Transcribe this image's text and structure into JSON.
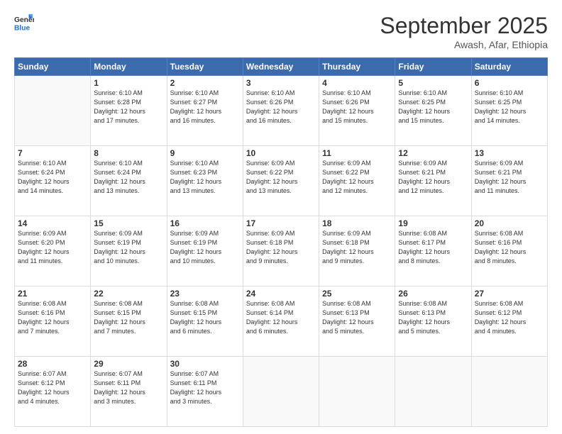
{
  "header": {
    "logo_line1": "General",
    "logo_line2": "Blue",
    "month": "September 2025",
    "location": "Awash, Afar, Ethiopia"
  },
  "weekdays": [
    "Sunday",
    "Monday",
    "Tuesday",
    "Wednesday",
    "Thursday",
    "Friday",
    "Saturday"
  ],
  "weeks": [
    [
      {
        "num": "",
        "info": ""
      },
      {
        "num": "1",
        "info": "Sunrise: 6:10 AM\nSunset: 6:28 PM\nDaylight: 12 hours\nand 17 minutes."
      },
      {
        "num": "2",
        "info": "Sunrise: 6:10 AM\nSunset: 6:27 PM\nDaylight: 12 hours\nand 16 minutes."
      },
      {
        "num": "3",
        "info": "Sunrise: 6:10 AM\nSunset: 6:26 PM\nDaylight: 12 hours\nand 16 minutes."
      },
      {
        "num": "4",
        "info": "Sunrise: 6:10 AM\nSunset: 6:26 PM\nDaylight: 12 hours\nand 15 minutes."
      },
      {
        "num": "5",
        "info": "Sunrise: 6:10 AM\nSunset: 6:25 PM\nDaylight: 12 hours\nand 15 minutes."
      },
      {
        "num": "6",
        "info": "Sunrise: 6:10 AM\nSunset: 6:25 PM\nDaylight: 12 hours\nand 14 minutes."
      }
    ],
    [
      {
        "num": "7",
        "info": "Sunrise: 6:10 AM\nSunset: 6:24 PM\nDaylight: 12 hours\nand 14 minutes."
      },
      {
        "num": "8",
        "info": "Sunrise: 6:10 AM\nSunset: 6:24 PM\nDaylight: 12 hours\nand 13 minutes."
      },
      {
        "num": "9",
        "info": "Sunrise: 6:10 AM\nSunset: 6:23 PM\nDaylight: 12 hours\nand 13 minutes."
      },
      {
        "num": "10",
        "info": "Sunrise: 6:09 AM\nSunset: 6:22 PM\nDaylight: 12 hours\nand 13 minutes."
      },
      {
        "num": "11",
        "info": "Sunrise: 6:09 AM\nSunset: 6:22 PM\nDaylight: 12 hours\nand 12 minutes."
      },
      {
        "num": "12",
        "info": "Sunrise: 6:09 AM\nSunset: 6:21 PM\nDaylight: 12 hours\nand 12 minutes."
      },
      {
        "num": "13",
        "info": "Sunrise: 6:09 AM\nSunset: 6:21 PM\nDaylight: 12 hours\nand 11 minutes."
      }
    ],
    [
      {
        "num": "14",
        "info": "Sunrise: 6:09 AM\nSunset: 6:20 PM\nDaylight: 12 hours\nand 11 minutes."
      },
      {
        "num": "15",
        "info": "Sunrise: 6:09 AM\nSunset: 6:19 PM\nDaylight: 12 hours\nand 10 minutes."
      },
      {
        "num": "16",
        "info": "Sunrise: 6:09 AM\nSunset: 6:19 PM\nDaylight: 12 hours\nand 10 minutes."
      },
      {
        "num": "17",
        "info": "Sunrise: 6:09 AM\nSunset: 6:18 PM\nDaylight: 12 hours\nand 9 minutes."
      },
      {
        "num": "18",
        "info": "Sunrise: 6:09 AM\nSunset: 6:18 PM\nDaylight: 12 hours\nand 9 minutes."
      },
      {
        "num": "19",
        "info": "Sunrise: 6:08 AM\nSunset: 6:17 PM\nDaylight: 12 hours\nand 8 minutes."
      },
      {
        "num": "20",
        "info": "Sunrise: 6:08 AM\nSunset: 6:16 PM\nDaylight: 12 hours\nand 8 minutes."
      }
    ],
    [
      {
        "num": "21",
        "info": "Sunrise: 6:08 AM\nSunset: 6:16 PM\nDaylight: 12 hours\nand 7 minutes."
      },
      {
        "num": "22",
        "info": "Sunrise: 6:08 AM\nSunset: 6:15 PM\nDaylight: 12 hours\nand 7 minutes."
      },
      {
        "num": "23",
        "info": "Sunrise: 6:08 AM\nSunset: 6:15 PM\nDaylight: 12 hours\nand 6 minutes."
      },
      {
        "num": "24",
        "info": "Sunrise: 6:08 AM\nSunset: 6:14 PM\nDaylight: 12 hours\nand 6 minutes."
      },
      {
        "num": "25",
        "info": "Sunrise: 6:08 AM\nSunset: 6:13 PM\nDaylight: 12 hours\nand 5 minutes."
      },
      {
        "num": "26",
        "info": "Sunrise: 6:08 AM\nSunset: 6:13 PM\nDaylight: 12 hours\nand 5 minutes."
      },
      {
        "num": "27",
        "info": "Sunrise: 6:08 AM\nSunset: 6:12 PM\nDaylight: 12 hours\nand 4 minutes."
      }
    ],
    [
      {
        "num": "28",
        "info": "Sunrise: 6:07 AM\nSunset: 6:12 PM\nDaylight: 12 hours\nand 4 minutes."
      },
      {
        "num": "29",
        "info": "Sunrise: 6:07 AM\nSunset: 6:11 PM\nDaylight: 12 hours\nand 3 minutes."
      },
      {
        "num": "30",
        "info": "Sunrise: 6:07 AM\nSunset: 6:11 PM\nDaylight: 12 hours\nand 3 minutes."
      },
      {
        "num": "",
        "info": ""
      },
      {
        "num": "",
        "info": ""
      },
      {
        "num": "",
        "info": ""
      },
      {
        "num": "",
        "info": ""
      }
    ]
  ]
}
